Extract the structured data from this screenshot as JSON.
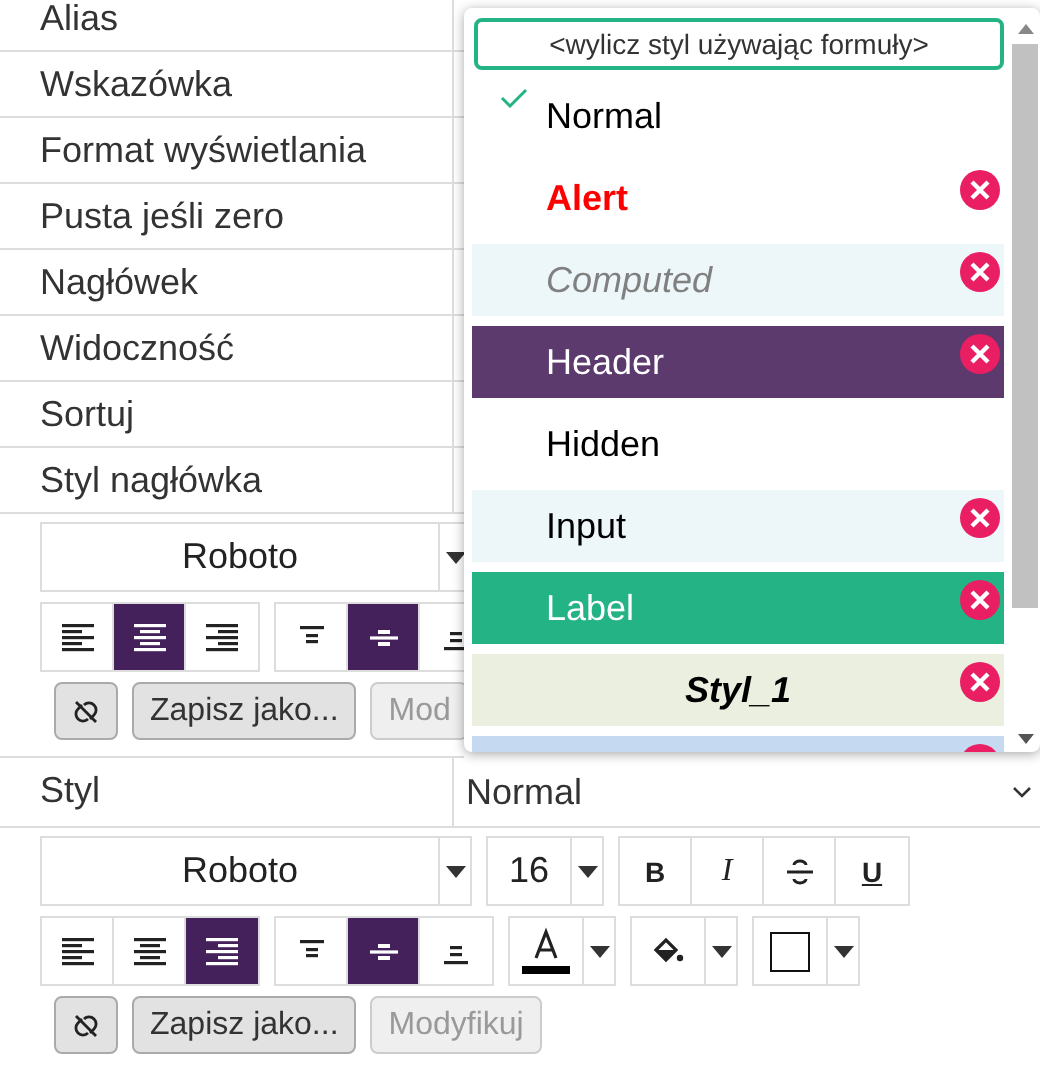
{
  "properties": [
    {
      "label": "Alias"
    },
    {
      "label": "Wskazówka"
    },
    {
      "label": "Format wyświetlania"
    },
    {
      "label": "Pusta jeśli zero"
    },
    {
      "label": "Nagłówek"
    },
    {
      "label": "Widoczność"
    },
    {
      "label": "Sortuj"
    },
    {
      "label": "Styl nagłówka"
    }
  ],
  "header_style_editor": {
    "font": "Roboto",
    "h_align": [
      {
        "kind": "left",
        "selected": false
      },
      {
        "kind": "center",
        "selected": true
      },
      {
        "kind": "right",
        "selected": false
      }
    ],
    "v_align": [
      {
        "kind": "top",
        "selected": false
      },
      {
        "kind": "middle",
        "selected": true
      },
      {
        "kind": "bottom",
        "selected": false
      }
    ],
    "buttons": [
      {
        "kind": "unlink"
      },
      {
        "kind": "text",
        "label": "Zapisz jako...",
        "disabled": false
      },
      {
        "kind": "text",
        "label": "Mod",
        "disabled": true
      }
    ]
  },
  "style_row": {
    "label": "Styl",
    "value": "Normal"
  },
  "style_editor": {
    "font": "Roboto",
    "size": "16",
    "format": [
      {
        "kind": "bold",
        "label": "B"
      },
      {
        "kind": "italic",
        "label": "I"
      },
      {
        "kind": "strike"
      },
      {
        "kind": "underline",
        "label": "U"
      }
    ],
    "h_align": [
      {
        "kind": "left",
        "selected": false
      },
      {
        "kind": "center",
        "selected": false
      },
      {
        "kind": "right",
        "selected": true
      }
    ],
    "v_align": [
      {
        "kind": "top",
        "selected": false
      },
      {
        "kind": "middle",
        "selected": true
      },
      {
        "kind": "bottom",
        "selected": false
      }
    ],
    "buttons": [
      {
        "kind": "unlink"
      },
      {
        "kind": "text",
        "label": "Zapisz jako...",
        "disabled": false
      },
      {
        "kind": "text",
        "label": "Modyfikuj",
        "disabled": true
      }
    ]
  },
  "style_dropdown": {
    "formula_button": "<wylicz styl używając formuły>",
    "items": [
      {
        "label": "Normal",
        "kind": "plain",
        "selected": true,
        "deletable": false
      },
      {
        "label": "Alert",
        "kind": "alert",
        "selected": false,
        "deletable": true
      },
      {
        "label": "Computed",
        "kind": "computed",
        "selected": false,
        "deletable": true
      },
      {
        "label": "Header",
        "kind": "header",
        "selected": false,
        "deletable": true
      },
      {
        "label": "Hidden",
        "kind": "plain",
        "selected": false,
        "deletable": false
      },
      {
        "label": "Input",
        "kind": "input",
        "selected": false,
        "deletable": true
      },
      {
        "label": "Label",
        "kind": "label",
        "selected": false,
        "deletable": true
      },
      {
        "label": "Styl_1",
        "kind": "custom",
        "selected": false,
        "deletable": true
      },
      {
        "kind": "blue",
        "selected": false,
        "deletable": true
      }
    ]
  }
}
